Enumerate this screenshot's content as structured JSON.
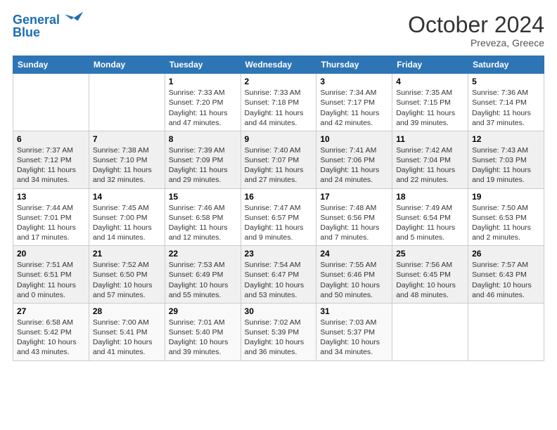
{
  "header": {
    "logo_line1": "General",
    "logo_line2": "Blue",
    "month": "October 2024",
    "location": "Preveza, Greece"
  },
  "weekdays": [
    "Sunday",
    "Monday",
    "Tuesday",
    "Wednesday",
    "Thursday",
    "Friday",
    "Saturday"
  ],
  "weeks": [
    [
      {
        "day": null,
        "sunrise": null,
        "sunset": null,
        "daylight": null
      },
      {
        "day": null,
        "sunrise": null,
        "sunset": null,
        "daylight": null
      },
      {
        "day": "1",
        "sunrise": "Sunrise: 7:33 AM",
        "sunset": "Sunset: 7:20 PM",
        "daylight": "Daylight: 11 hours and 47 minutes."
      },
      {
        "day": "2",
        "sunrise": "Sunrise: 7:33 AM",
        "sunset": "Sunset: 7:18 PM",
        "daylight": "Daylight: 11 hours and 44 minutes."
      },
      {
        "day": "3",
        "sunrise": "Sunrise: 7:34 AM",
        "sunset": "Sunset: 7:17 PM",
        "daylight": "Daylight: 11 hours and 42 minutes."
      },
      {
        "day": "4",
        "sunrise": "Sunrise: 7:35 AM",
        "sunset": "Sunset: 7:15 PM",
        "daylight": "Daylight: 11 hours and 39 minutes."
      },
      {
        "day": "5",
        "sunrise": "Sunrise: 7:36 AM",
        "sunset": "Sunset: 7:14 PM",
        "daylight": "Daylight: 11 hours and 37 minutes."
      }
    ],
    [
      {
        "day": "6",
        "sunrise": "Sunrise: 7:37 AM",
        "sunset": "Sunset: 7:12 PM",
        "daylight": "Daylight: 11 hours and 34 minutes."
      },
      {
        "day": "7",
        "sunrise": "Sunrise: 7:38 AM",
        "sunset": "Sunset: 7:10 PM",
        "daylight": "Daylight: 11 hours and 32 minutes."
      },
      {
        "day": "8",
        "sunrise": "Sunrise: 7:39 AM",
        "sunset": "Sunset: 7:09 PM",
        "daylight": "Daylight: 11 hours and 29 minutes."
      },
      {
        "day": "9",
        "sunrise": "Sunrise: 7:40 AM",
        "sunset": "Sunset: 7:07 PM",
        "daylight": "Daylight: 11 hours and 27 minutes."
      },
      {
        "day": "10",
        "sunrise": "Sunrise: 7:41 AM",
        "sunset": "Sunset: 7:06 PM",
        "daylight": "Daylight: 11 hours and 24 minutes."
      },
      {
        "day": "11",
        "sunrise": "Sunrise: 7:42 AM",
        "sunset": "Sunset: 7:04 PM",
        "daylight": "Daylight: 11 hours and 22 minutes."
      },
      {
        "day": "12",
        "sunrise": "Sunrise: 7:43 AM",
        "sunset": "Sunset: 7:03 PM",
        "daylight": "Daylight: 11 hours and 19 minutes."
      }
    ],
    [
      {
        "day": "13",
        "sunrise": "Sunrise: 7:44 AM",
        "sunset": "Sunset: 7:01 PM",
        "daylight": "Daylight: 11 hours and 17 minutes."
      },
      {
        "day": "14",
        "sunrise": "Sunrise: 7:45 AM",
        "sunset": "Sunset: 7:00 PM",
        "daylight": "Daylight: 11 hours and 14 minutes."
      },
      {
        "day": "15",
        "sunrise": "Sunrise: 7:46 AM",
        "sunset": "Sunset: 6:58 PM",
        "daylight": "Daylight: 11 hours and 12 minutes."
      },
      {
        "day": "16",
        "sunrise": "Sunrise: 7:47 AM",
        "sunset": "Sunset: 6:57 PM",
        "daylight": "Daylight: 11 hours and 9 minutes."
      },
      {
        "day": "17",
        "sunrise": "Sunrise: 7:48 AM",
        "sunset": "Sunset: 6:56 PM",
        "daylight": "Daylight: 11 hours and 7 minutes."
      },
      {
        "day": "18",
        "sunrise": "Sunrise: 7:49 AM",
        "sunset": "Sunset: 6:54 PM",
        "daylight": "Daylight: 11 hours and 5 minutes."
      },
      {
        "day": "19",
        "sunrise": "Sunrise: 7:50 AM",
        "sunset": "Sunset: 6:53 PM",
        "daylight": "Daylight: 11 hours and 2 minutes."
      }
    ],
    [
      {
        "day": "20",
        "sunrise": "Sunrise: 7:51 AM",
        "sunset": "Sunset: 6:51 PM",
        "daylight": "Daylight: 11 hours and 0 minutes."
      },
      {
        "day": "21",
        "sunrise": "Sunrise: 7:52 AM",
        "sunset": "Sunset: 6:50 PM",
        "daylight": "Daylight: 10 hours and 57 minutes."
      },
      {
        "day": "22",
        "sunrise": "Sunrise: 7:53 AM",
        "sunset": "Sunset: 6:49 PM",
        "daylight": "Daylight: 10 hours and 55 minutes."
      },
      {
        "day": "23",
        "sunrise": "Sunrise: 7:54 AM",
        "sunset": "Sunset: 6:47 PM",
        "daylight": "Daylight: 10 hours and 53 minutes."
      },
      {
        "day": "24",
        "sunrise": "Sunrise: 7:55 AM",
        "sunset": "Sunset: 6:46 PM",
        "daylight": "Daylight: 10 hours and 50 minutes."
      },
      {
        "day": "25",
        "sunrise": "Sunrise: 7:56 AM",
        "sunset": "Sunset: 6:45 PM",
        "daylight": "Daylight: 10 hours and 48 minutes."
      },
      {
        "day": "26",
        "sunrise": "Sunrise: 7:57 AM",
        "sunset": "Sunset: 6:43 PM",
        "daylight": "Daylight: 10 hours and 46 minutes."
      }
    ],
    [
      {
        "day": "27",
        "sunrise": "Sunrise: 6:58 AM",
        "sunset": "Sunset: 5:42 PM",
        "daylight": "Daylight: 10 hours and 43 minutes."
      },
      {
        "day": "28",
        "sunrise": "Sunrise: 7:00 AM",
        "sunset": "Sunset: 5:41 PM",
        "daylight": "Daylight: 10 hours and 41 minutes."
      },
      {
        "day": "29",
        "sunrise": "Sunrise: 7:01 AM",
        "sunset": "Sunset: 5:40 PM",
        "daylight": "Daylight: 10 hours and 39 minutes."
      },
      {
        "day": "30",
        "sunrise": "Sunrise: 7:02 AM",
        "sunset": "Sunset: 5:39 PM",
        "daylight": "Daylight: 10 hours and 36 minutes."
      },
      {
        "day": "31",
        "sunrise": "Sunrise: 7:03 AM",
        "sunset": "Sunset: 5:37 PM",
        "daylight": "Daylight: 10 hours and 34 minutes."
      },
      {
        "day": null,
        "sunrise": null,
        "sunset": null,
        "daylight": null
      },
      {
        "day": null,
        "sunrise": null,
        "sunset": null,
        "daylight": null
      }
    ]
  ]
}
